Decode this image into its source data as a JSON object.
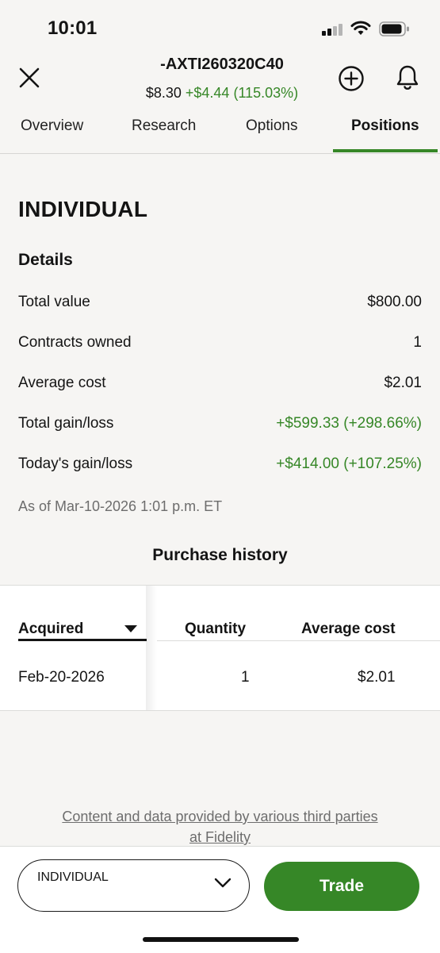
{
  "status_bar": {
    "time": "10:01"
  },
  "header": {
    "symbol": "-AXTI260320C40",
    "price": "$8.30",
    "change": "+$4.44 (115.03%)"
  },
  "tabs": [
    {
      "label": "Overview",
      "active": false
    },
    {
      "label": "Research",
      "active": false
    },
    {
      "label": "Options",
      "active": false
    },
    {
      "label": "Positions",
      "active": true
    }
  ],
  "account": {
    "name": "INDIVIDUAL"
  },
  "details": {
    "heading": "Details",
    "rows": [
      {
        "label": "Total value",
        "value": "$800.00"
      },
      {
        "label": "Contracts owned",
        "value": "1"
      },
      {
        "label": "Average cost",
        "value": "$2.01"
      },
      {
        "label": "Total gain/loss",
        "value": "+$599.33 (+298.66%)"
      },
      {
        "label": "Today's gain/loss",
        "value": "+$414.00 (+107.25%)"
      }
    ],
    "as_of": "As of Mar-10-2026 1:01 p.m. ET"
  },
  "purchase_history": {
    "title": "Purchase history",
    "columns": [
      "Acquired",
      "Quantity",
      "Average cost"
    ],
    "rows": [
      {
        "acquired": "Feb-20-2026",
        "quantity": "1",
        "average_cost": "$2.01"
      }
    ]
  },
  "disclaimer": {
    "line1": "Content and data provided by various third parties",
    "line2": "at Fidelity"
  },
  "bottom_bar": {
    "account_select": "INDIVIDUAL",
    "trade_label": "Trade"
  },
  "colors": {
    "accent_green": "#368727",
    "background": "#f6f5f3"
  }
}
